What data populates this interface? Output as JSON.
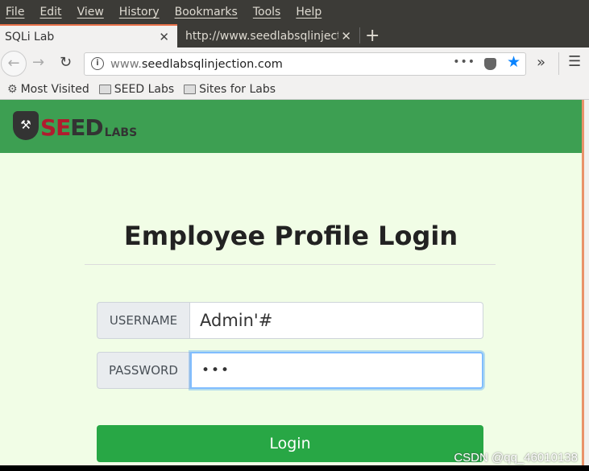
{
  "menu": [
    "File",
    "Edit",
    "View",
    "History",
    "Bookmarks",
    "Tools",
    "Help"
  ],
  "tabs": [
    {
      "label": "SQLi Lab",
      "active": true
    },
    {
      "label": "http://www.seedlabsqlinjection.com/",
      "active": false
    }
  ],
  "url": {
    "domain_prefix": "www.",
    "domain": "seedlabsqlinjection.com"
  },
  "bookmarks": [
    "Most Visited",
    "SEED Labs",
    "Sites for Labs"
  ],
  "logo": {
    "text": "SEEDLABS"
  },
  "page": {
    "title": "Employee Profile Login",
    "username_label": "USERNAME",
    "username_value": "Admin'#",
    "password_label": "PASSWORD",
    "password_value": "•••",
    "login_label": "Login"
  },
  "watermark": "CSDN @qq_46010138",
  "colors": {
    "header": "#3d9f52",
    "button": "#28a745",
    "background": "#f1fde6"
  }
}
